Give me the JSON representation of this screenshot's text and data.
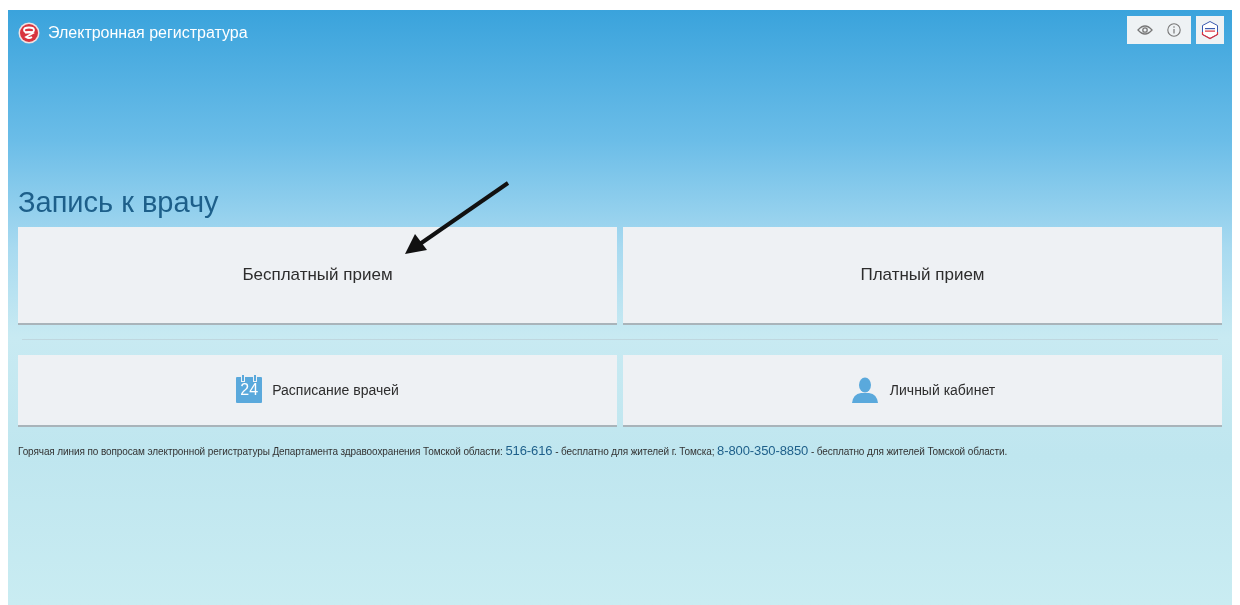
{
  "header": {
    "title": "Электронная регистратура"
  },
  "toolbar": [
    {
      "kind": "eye"
    },
    {
      "kind": "info"
    }
  ],
  "heading": "Запись к врачу",
  "main_buttons": [
    {
      "label": "Бесплатный прием"
    },
    {
      "label": "Платный прием"
    }
  ],
  "secondary_buttons": [
    {
      "label": "Расписание врачей",
      "kind": "calendar",
      "icon_text": "24"
    },
    {
      "label": "Личный кабинет",
      "kind": "person"
    }
  ],
  "hotline": [
    {
      "kind": "text",
      "text": "Горячая линия по вопросам электронной регистратуры Департамента здравоохранения Томской области:"
    },
    {
      "kind": "phone",
      "text": "516-616"
    },
    {
      "kind": "text",
      "text": "- бесплатно для жителей г. Томска;"
    },
    {
      "kind": "phone",
      "text": "8-800-350-8850"
    },
    {
      "kind": "text",
      "text": "- бесплатно для жителей Томской области."
    }
  ],
  "annotation": {
    "kind": "arrow"
  }
}
